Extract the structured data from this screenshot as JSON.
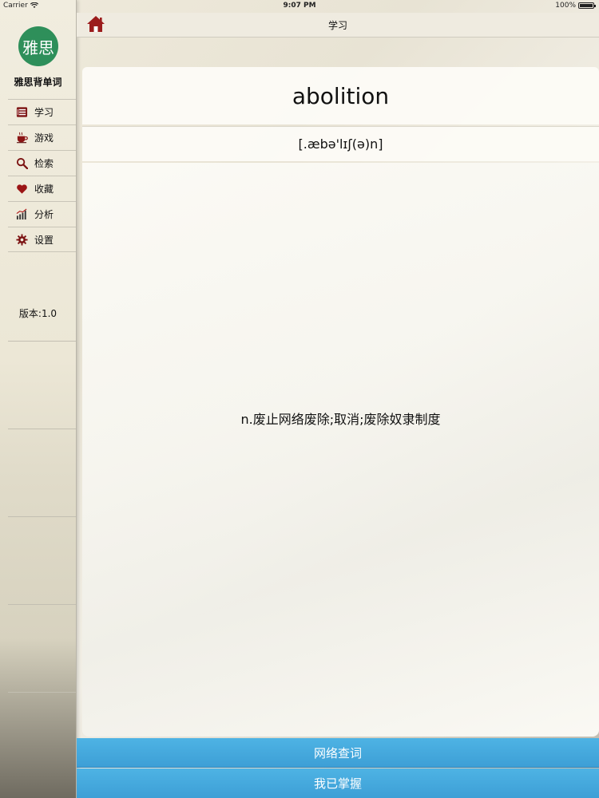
{
  "status_bar": {
    "carrier": "Carrier",
    "time": "9:07 PM",
    "battery": "100%"
  },
  "sidebar": {
    "logo_text": "雅思",
    "app_name": "雅思背单词",
    "items": [
      {
        "label": "学习",
        "icon": "book-icon"
      },
      {
        "label": "游戏",
        "icon": "coffee-cup-icon"
      },
      {
        "label": "检索",
        "icon": "magnifier-icon"
      },
      {
        "label": "收藏",
        "icon": "heart-icon"
      },
      {
        "label": "分析",
        "icon": "bar-chart-icon"
      },
      {
        "label": "设置",
        "icon": "gear-icon"
      }
    ],
    "version": "版本:1.0"
  },
  "navbar": {
    "title": "学习",
    "home_icon": "home-icon"
  },
  "word": {
    "term": "abolition",
    "phonetic": "[.æbə'lɪʃ(ə)n]",
    "definition": "n.废止网络废除;取消;废除奴隶制度"
  },
  "buttons": {
    "lookup": "网络查词",
    "mastered": "我已掌握"
  },
  "colors": {
    "button_blue": "#45a8dd",
    "logo_green": "#2e8f5a",
    "home_red": "#9b1c1c"
  }
}
